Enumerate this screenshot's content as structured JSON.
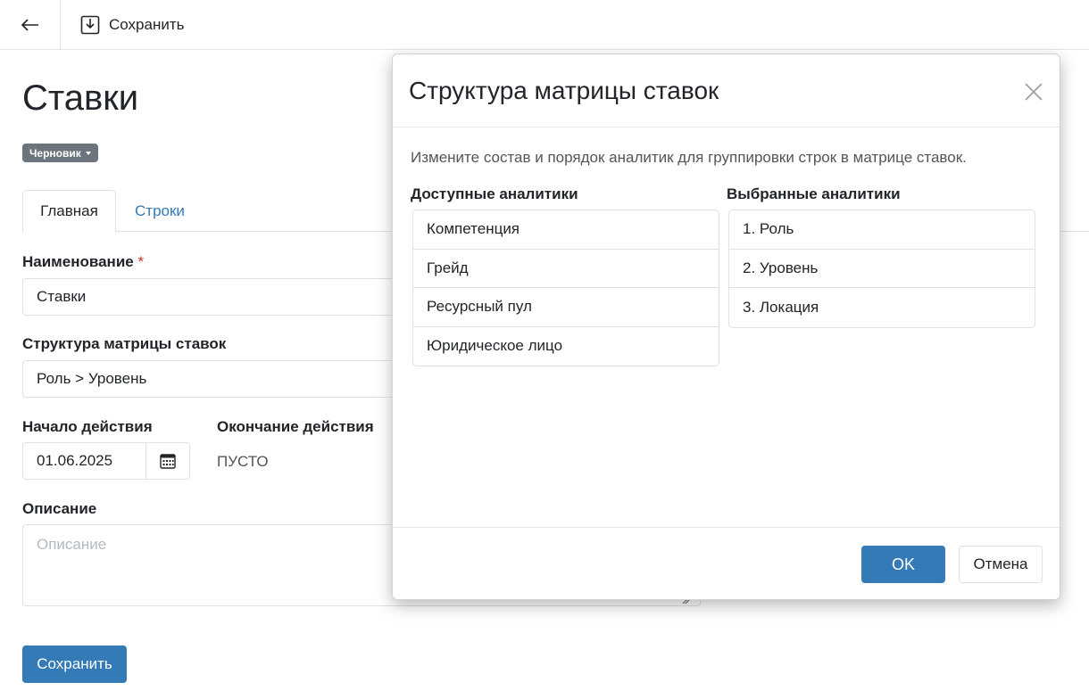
{
  "toolbar": {
    "back_icon": "arrow-left-icon",
    "save_icon": "download-box-icon",
    "save_label": "Сохранить"
  },
  "page": {
    "title": "Ставки",
    "status": "Черновик",
    "tabs": [
      {
        "label": "Главная"
      },
      {
        "label": "Строки"
      }
    ]
  },
  "form": {
    "name_label": "Наименование",
    "required_mark": "*",
    "name_value": "Ставки",
    "structure_label": "Структура матрицы ставок",
    "structure_value": "Роль > Уровень",
    "start_label": "Начало действия",
    "start_value": "01.06.2025",
    "end_label": "Окончание действия",
    "end_value": "ПУСТО",
    "description_label": "Описание",
    "description_placeholder": "Описание",
    "save_button": "Сохранить"
  },
  "modal": {
    "title": "Структура матрицы ставок",
    "description": "Измените состав и порядок аналитик для группировки строк в матрице ставок.",
    "available_title": "Доступные аналитики",
    "available": [
      "Компетенция",
      "Грейд",
      "Ресурсный пул",
      "Юридическое лицо"
    ],
    "selected_title": "Выбранные аналитики",
    "selected": [
      "1. Роль",
      "2. Уровень",
      "3. Локация"
    ],
    "ok": "OK",
    "cancel": "Отмена"
  },
  "colors": {
    "primary": "#337ab7",
    "badge": "#6c757d",
    "required": "#c0392b"
  }
}
